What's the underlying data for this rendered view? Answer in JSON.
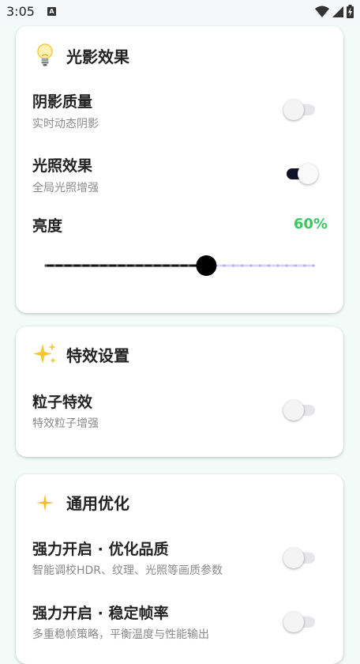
{
  "status_bar": {
    "time": "3:05",
    "notification_icon": "app-a-icon",
    "icons": [
      "wifi-icon",
      "signal-icon",
      "battery-icon"
    ]
  },
  "cards": {
    "lighting": {
      "emoji": "lightbulb-icon",
      "title": "光影效果",
      "shadow_quality": {
        "title": "阴影质量",
        "sub": "实时动态阴影",
        "enabled": false
      },
      "lighting_effect": {
        "title": "光照效果",
        "sub": "全局光照增强",
        "enabled": true
      },
      "brightness": {
        "label": "亮度",
        "value_text": "60%",
        "value": 0.6
      }
    },
    "effects": {
      "emoji": "sparkles-icon",
      "title": "特效设置",
      "particles": {
        "title": "粒子特效",
        "sub": "特效粒子增强",
        "enabled": false
      }
    },
    "general": {
      "emoji": "sparkle-icon",
      "title": "通用优化",
      "quality": {
        "title": "强力开启 · 优化品质",
        "sub": "智能调校HDR、纹理、光照等画质参数",
        "enabled": false
      },
      "framerate": {
        "title": "强力开启 · 稳定帧率",
        "sub": "多重稳帧策略，平衡温度与性能输出",
        "enabled": false
      }
    }
  },
  "colors": {
    "accent_green": "#3cc85f",
    "toggle_on": "#12122a",
    "slider_inactive": "#b7b0f0"
  }
}
